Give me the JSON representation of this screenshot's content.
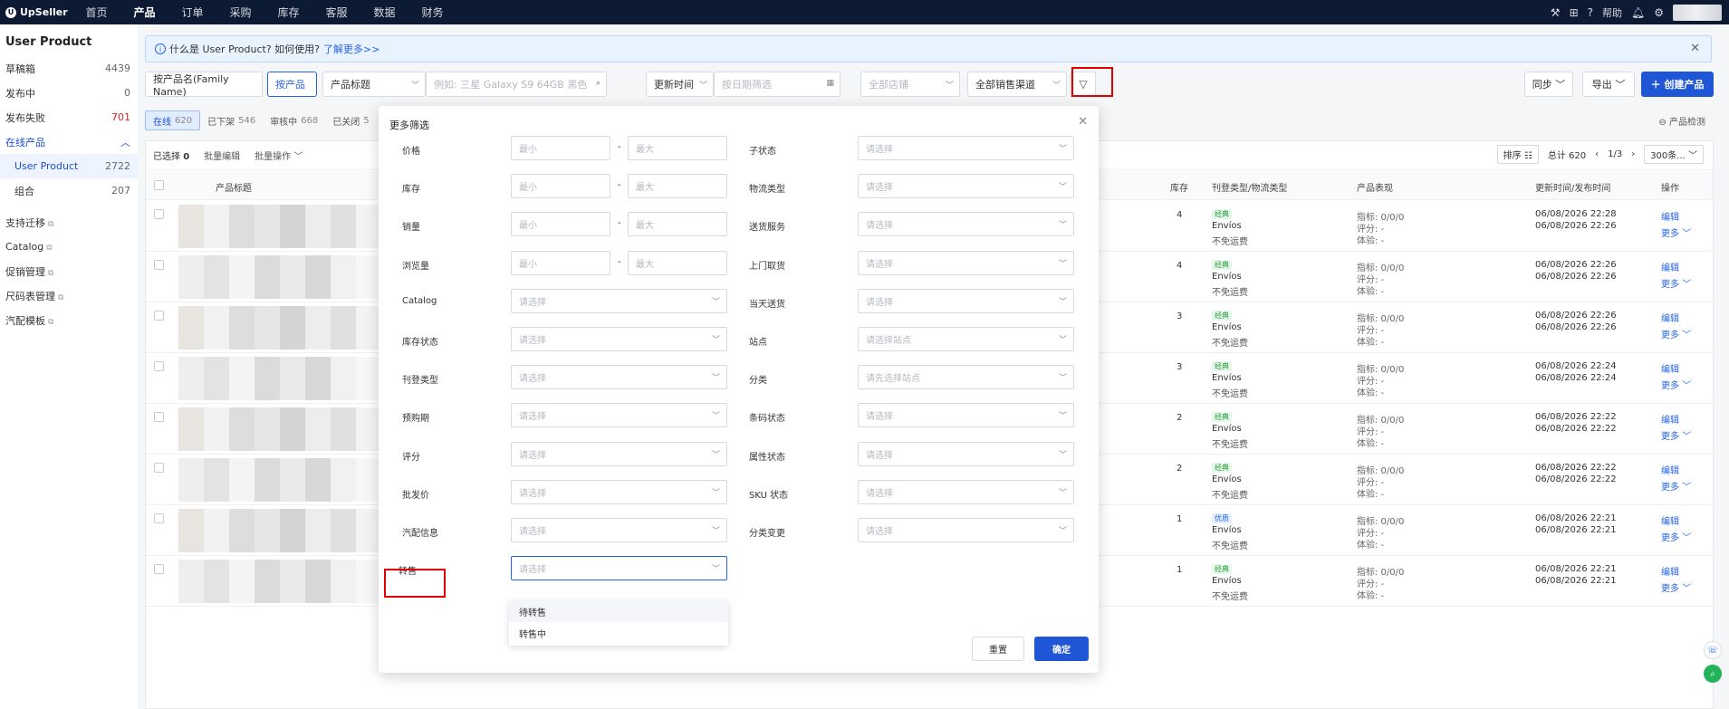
{
  "topbar": {
    "logo": "UpSeller",
    "nav": [
      "首页",
      "产品",
      "订单",
      "采购",
      "库存",
      "客服",
      "数据",
      "财务"
    ],
    "active_nav": "产品",
    "help": "帮助"
  },
  "sidebar": {
    "title": "User Product",
    "items": [
      {
        "label": "草稿箱",
        "count": "4439"
      },
      {
        "label": "发布中",
        "count": "0"
      },
      {
        "label": "发布失败",
        "count": "701"
      }
    ],
    "group_label": "在线产品",
    "sub_items": [
      {
        "label": "User Product",
        "count": "2722"
      },
      {
        "label": "组合",
        "count": "207"
      }
    ],
    "links": [
      "支持迁移",
      "Catalog",
      "促销管理",
      "尺码表管理",
      "汽配模板"
    ]
  },
  "notice": {
    "text": "什么是 User Product? 如何使用?",
    "link": "了解更多>>"
  },
  "filters": {
    "by_family": "按产品名(Family Name)",
    "by_product": "按产品",
    "title_select": "产品标题",
    "search_placeholder": "例如: 三星 Galaxy S9 64GB 黑色",
    "time_select": "更新时间",
    "date_placeholder": "按日期筛选",
    "store_select": "全部店铺",
    "channel_select": "全部销售渠道"
  },
  "actions": {
    "sync": "同步",
    "export": "导出",
    "create": "创建产品"
  },
  "tabs": [
    {
      "label": "在线",
      "count": "620"
    },
    {
      "label": "已下架",
      "count": "546"
    },
    {
      "label": "审核中",
      "count": "668"
    },
    {
      "label": "已关闭",
      "count": "5"
    }
  ],
  "product_check": "产品检测",
  "toolbar": {
    "selected_label": "已选择",
    "selected_count": "0",
    "batch_edit": "批量编辑",
    "batch_ops": "批量操作",
    "sort": "排序",
    "total": "总计 620",
    "page": "1/3",
    "per_page": "300条..."
  },
  "table": {
    "headers": {
      "title": "产品标题",
      "stock": "库存",
      "listing_type": "刊登类型/物流类型",
      "performance": "产品表现",
      "time": "更新时间/发布时间",
      "op": "操作"
    },
    "rows": [
      {
        "stock": "4",
        "badge": "经典",
        "badge_type": "green",
        "logistics": "Envíos",
        "shipping": "不免运费",
        "metric": "指标: 0/0/0",
        "rating": "评分: -",
        "exp": "体验: -",
        "t1": "06/08/2026 22:28",
        "t2": "06/08/2026 22:26"
      },
      {
        "stock": "4",
        "badge": "经典",
        "badge_type": "green",
        "logistics": "Envíos",
        "shipping": "不免运费",
        "metric": "指标: 0/0/0",
        "rating": "评分: -",
        "exp": "体验: -",
        "t1": "06/08/2026 22:26",
        "t2": "06/08/2026 22:26"
      },
      {
        "stock": "3",
        "badge": "经典",
        "badge_type": "green",
        "logistics": "Envíos",
        "shipping": "不免运费",
        "metric": "指标: 0/0/0",
        "rating": "评分: -",
        "exp": "体验: -",
        "t1": "06/08/2026 22:26",
        "t2": "06/08/2026 22:26"
      },
      {
        "stock": "3",
        "badge": "经典",
        "badge_type": "green",
        "logistics": "Envíos",
        "shipping": "不免运费",
        "metric": "指标: 0/0/0",
        "rating": "评分: -",
        "exp": "体验: -",
        "t1": "06/08/2026 22:24",
        "t2": "06/08/2026 22:24"
      },
      {
        "stock": "2",
        "badge": "经典",
        "badge_type": "green",
        "logistics": "Envíos",
        "shipping": "不免运费",
        "metric": "指标: 0/0/0",
        "rating": "评分: -",
        "exp": "体验: -",
        "t1": "06/08/2026 22:22",
        "t2": "06/08/2026 22:22"
      },
      {
        "stock": "2",
        "badge": "经典",
        "badge_type": "green",
        "logistics": "Envíos",
        "shipping": "不免运费",
        "metric": "指标: 0/0/0",
        "rating": "评分: -",
        "exp": "体验: -",
        "t1": "06/08/2026 22:22",
        "t2": "06/08/2026 22:22"
      },
      {
        "stock": "1",
        "badge": "优质",
        "badge_type": "blue",
        "logistics": "Envíos",
        "shipping": "不免运费",
        "metric": "指标: 0/0/0",
        "rating": "评分: -",
        "exp": "体验: -",
        "t1": "06/08/2026 22:21",
        "t2": "06/08/2026 22:21"
      },
      {
        "stock": "1",
        "badge": "经典",
        "badge_type": "green",
        "logistics": "Envíos",
        "shipping": "不免运费",
        "metric": "指标: 0/0/0",
        "rating": "评分: -",
        "exp": "体验: -",
        "t1": "06/08/2026 22:21",
        "t2": "06/08/2026 22:21"
      }
    ],
    "edit_label": "编辑",
    "more_label": "更多"
  },
  "modal": {
    "title": "更多筛选",
    "min_placeholder": "最小",
    "max_placeholder": "最大",
    "select_placeholder": "请选择",
    "site_placeholder": "请选择站点",
    "site_first_placeholder": "请先选择站点",
    "left_labels": [
      "价格",
      "库存",
      "销量",
      "浏览量",
      "Catalog",
      "库存状态",
      "刊登类型",
      "预购期",
      "评分",
      "批发价",
      "汽配信息",
      "转售"
    ],
    "right_labels": [
      "子状态",
      "物流类型",
      "送货服务",
      "上门取货",
      "当天送货",
      "站点",
      "分类",
      "条码状态",
      "属性状态",
      "SKU 状态",
      "分类变更"
    ],
    "dropdown_options": [
      "待转售",
      "转售中"
    ],
    "reset": "重置",
    "confirm": "确定"
  }
}
